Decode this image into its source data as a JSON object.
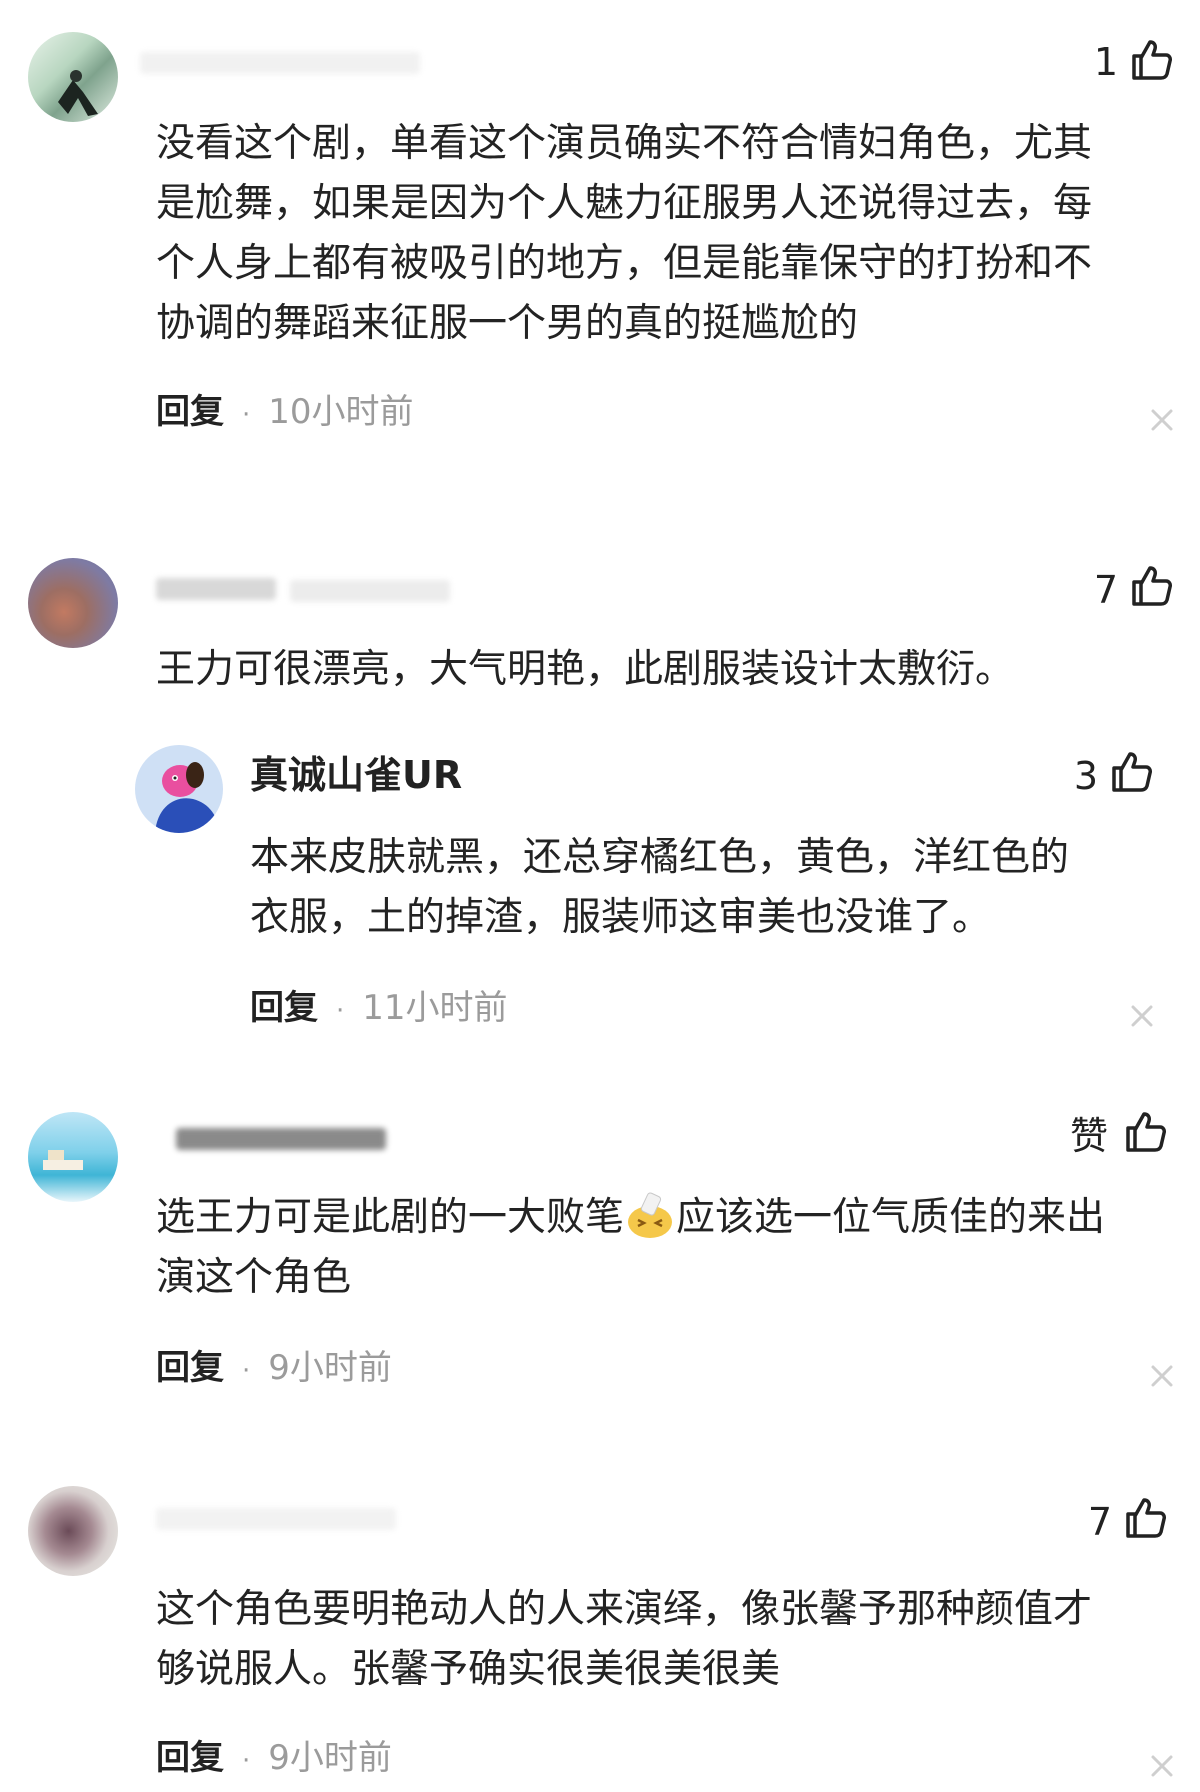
{
  "comments": [
    {
      "likes": "1",
      "lines": [
        "没看这个剧，单看这个演员确实不符合情妇角色，尤其",
        "是尬舞，如果是因为个人魅力征服男人还说得过去，每",
        "个人身上都有被吸引的地方，但是能靠保守的打扮和不",
        "协调的舞蹈来征服一个男的真的挺尴尬的"
      ],
      "reply_label": "回复",
      "dot": "·",
      "time": "10小时前"
    },
    {
      "likes": "7",
      "lines": [
        "王力可很漂亮，大气明艳，此剧服装设计太敷衍。"
      ],
      "reply": {
        "username": "真诚山雀UR",
        "likes": "3",
        "lines": [
          "本来皮肤就黑，还总穿橘红色，黄色，洋红色的",
          "衣服，土的掉渣，服装师这审美也没谁了。"
        ],
        "reply_label": "回复",
        "dot": "·",
        "time": "11小时前"
      }
    },
    {
      "likes": "赞",
      "lines_a": "选王力可是此剧的一大败笔",
      "lines_b": "应该选一位气质佳的来出",
      "line2": "演这个角色",
      "emoji": "facepalm-emoji",
      "reply_label": "回复",
      "dot": "·",
      "time": "9小时前"
    },
    {
      "likes": "7",
      "lines": [
        "这个角色要明艳动人的人来演绎，像张馨予那种颜值才",
        "够说服人。张馨予确实很美很美很美"
      ],
      "reply_label": "回复",
      "dot": "·",
      "time": "9小时前"
    }
  ],
  "colors": {
    "text": "#232323",
    "muted": "#9b9b9b",
    "close": "#cfcfcf"
  },
  "icons": {
    "like": "thumbs-up-icon",
    "close": "close-icon"
  }
}
